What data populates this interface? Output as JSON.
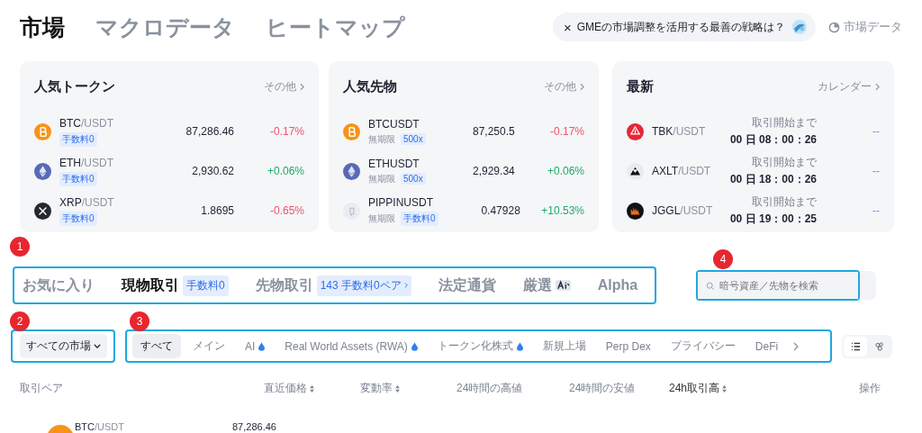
{
  "nav": {
    "tabs": [
      {
        "label": "市場",
        "selected": true
      },
      {
        "label": "マクロデータ",
        "selected": false
      },
      {
        "label": "ヒートマップ",
        "selected": false
      }
    ]
  },
  "ai_prompt": {
    "close": "×",
    "text": "GMEの市場調整を活用する最善の戦略は？"
  },
  "market_data_link": "市場データ",
  "cards": [
    {
      "kind": "market",
      "title": "人気トークン",
      "more": "その他",
      "rows": [
        {
          "kind": "btc",
          "base": "BTC",
          "quote": "/USDT",
          "sub": null,
          "tag": "手数料0",
          "price": "87,286.46",
          "change": "-0.17%",
          "color": "#f0506e"
        },
        {
          "kind": "eth",
          "base": "ETH",
          "quote": "/USDT",
          "sub": null,
          "tag": "手数料0",
          "price": "2,930.62",
          "change": "+0.06%",
          "color": "#20a86b"
        },
        {
          "kind": "xrp",
          "base": "XRP",
          "quote": "/USDT",
          "sub": null,
          "tag": "手数料0",
          "price": "1.8695",
          "change": "-0.65%",
          "color": "#f0506e"
        }
      ]
    },
    {
      "kind": "market",
      "title": "人気先物",
      "more": "その他",
      "rows": [
        {
          "kind": "btc",
          "base": "BTCUSDT",
          "quote": null,
          "sub": "無期限",
          "tag": "500x",
          "price": "87,250.5",
          "change": "-0.17%",
          "color": "#f0506e"
        },
        {
          "kind": "eth",
          "base": "ETHUSDT",
          "quote": null,
          "sub": "無期限",
          "tag": "500x",
          "price": "2,929.34",
          "change": "+0.06%",
          "color": "#20a86b"
        },
        {
          "kind": "pippin",
          "base": "PIPPINUSDT",
          "quote": null,
          "sub": "無期限",
          "tag": "手数料0",
          "price": "0.47928",
          "change": "+10.53%",
          "color": "#20a86b"
        }
      ]
    },
    {
      "kind": "listing",
      "title": "最新",
      "more": "カレンダー",
      "rows": [
        {
          "kind": "tbk",
          "base": "TBK",
          "quote": "/USDT",
          "countdown_label": "取引開始まで",
          "countdown": "00 日 08：00：26",
          "change": "--",
          "color": "#6b8ee8"
        },
        {
          "kind": "axlt",
          "base": "AXLT",
          "quote": "/USDT",
          "countdown_label": "取引開始まで",
          "countdown": "00 日 18：00：26",
          "change": "--",
          "color": "#6b8ee8"
        },
        {
          "kind": "jggl",
          "base": "JGGL",
          "quote": "/USDT",
          "countdown_label": "取引開始まで",
          "countdown": "00 日 19：00：25",
          "change": "--",
          "color": "#6b8ee8"
        }
      ]
    }
  ],
  "market_tabs": [
    {
      "label": "お気に入り",
      "selected": false
    },
    {
      "label": "現物取引",
      "selected": true,
      "badge": "手数料0"
    },
    {
      "label": "先物取引",
      "selected": false,
      "badge": "143 手数料0ペア",
      "badge_arrow": true
    },
    {
      "label": "法定通貨",
      "selected": false
    },
    {
      "label": "厳選",
      "selected": false,
      "ai_icon": true
    },
    {
      "label": "Alpha",
      "selected": false
    }
  ],
  "search": {
    "placeholder": "暗号資産／先物を検索"
  },
  "market_select": {
    "value": "すべての市場"
  },
  "categories": [
    {
      "label": "すべて",
      "selected": true,
      "hot": false
    },
    {
      "label": "メイン",
      "selected": false,
      "hot": false
    },
    {
      "label": "AI",
      "selected": false,
      "hot": true
    },
    {
      "label": "Real World Assets (RWA)",
      "selected": false,
      "hot": true
    },
    {
      "label": "トークン化株式",
      "selected": false,
      "hot": true
    },
    {
      "label": "新規上場",
      "selected": false,
      "hot": false
    },
    {
      "label": "Perp Dex",
      "selected": false,
      "hot": false
    },
    {
      "label": "プライバシー",
      "selected": false,
      "hot": false
    },
    {
      "label": "DeFi",
      "selected": false,
      "hot": false
    }
  ],
  "view_toggle": [
    {
      "kind": "list",
      "selected": true
    },
    {
      "kind": "grid",
      "selected": false
    }
  ],
  "table": {
    "columns": [
      {
        "label": "取引ペア",
        "sortable": false
      },
      {
        "label": "直近価格",
        "sortable": true
      },
      {
        "label": "変動率",
        "sortable": true
      },
      {
        "label": "24時間の高値",
        "sortable": false
      },
      {
        "label": "24時間の安値",
        "sortable": false
      },
      {
        "label": "24h取引高",
        "sortable": true
      },
      {
        "label": "操作",
        "sortable": false
      }
    ],
    "rows": [
      {
        "kind": "btc",
        "base": "BTC",
        "quote": "/USDT",
        "price": "87,286.46"
      }
    ]
  },
  "annotations": [
    "1",
    "2",
    "3",
    "4"
  ]
}
